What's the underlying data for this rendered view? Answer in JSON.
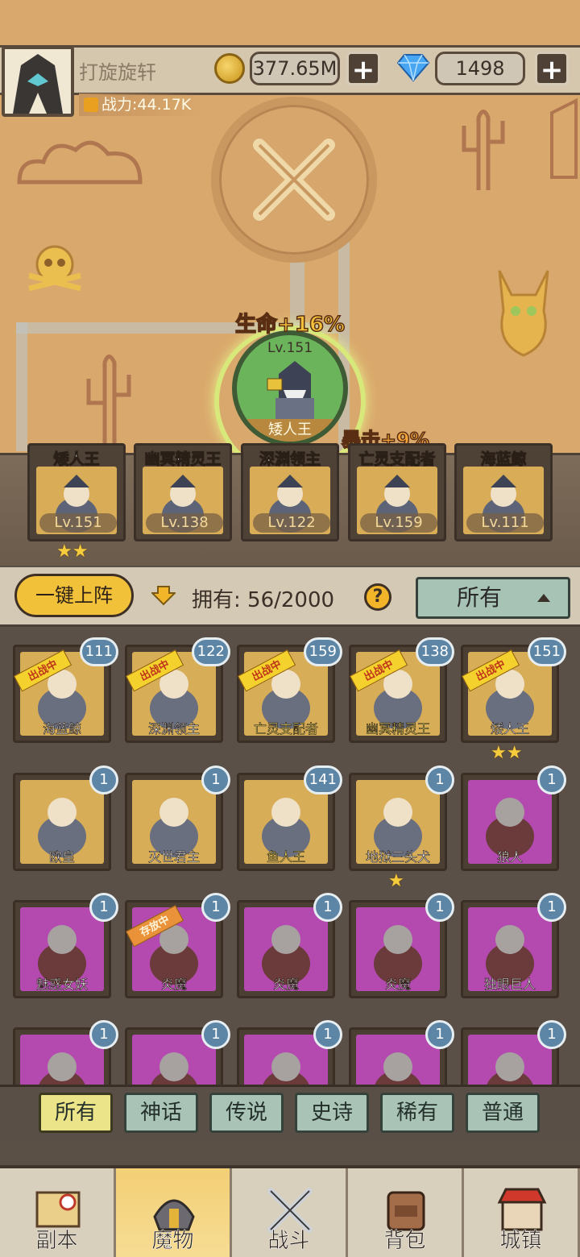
{
  "player": {
    "name": "打旋旋轩",
    "power": "战力:44.17K"
  },
  "currency": {
    "gold": "377.65M",
    "gems": "1498",
    "plus": "+"
  },
  "selected_hero": {
    "level": "Lv.151",
    "name": "矮人王",
    "buff_hp": "生命+16%",
    "buff_crit": "暴击+9%"
  },
  "lineup": [
    {
      "name": "矮人王",
      "level": "Lv.151",
      "stars": "★★"
    },
    {
      "name": "幽冥精灵王",
      "level": "Lv.138",
      "stars": ""
    },
    {
      "name": "深渊领主",
      "level": "Lv.122",
      "stars": ""
    },
    {
      "name": "亡灵支配者",
      "level": "Lv.159",
      "stars": ""
    },
    {
      "name": "海蓝鲸",
      "level": "Lv.111",
      "stars": ""
    }
  ],
  "toolbar": {
    "quick_deploy": "一键上阵",
    "owned_label": "拥有:",
    "owned_value": "56/2000",
    "help": "?",
    "filter": "所有"
  },
  "ribbons": {
    "in_battle": "出战中",
    "stored": "存放中"
  },
  "grid": [
    {
      "name": "海蓝鲸",
      "count": "111",
      "color": "gold",
      "ribbon": "in_battle",
      "stars": ""
    },
    {
      "name": "深渊领主",
      "count": "122",
      "color": "gold",
      "ribbon": "in_battle",
      "stars": ""
    },
    {
      "name": "亡灵支配者",
      "count": "159",
      "color": "gold",
      "ribbon": "in_battle",
      "stars": ""
    },
    {
      "name": "幽冥精灵王",
      "count": "138",
      "color": "gold",
      "ribbon": "in_battle",
      "stars": ""
    },
    {
      "name": "矮人王",
      "count": "151",
      "color": "gold",
      "ribbon": "in_battle",
      "stars": "★★"
    },
    {
      "name": "欧皇",
      "count": "1",
      "color": "gold",
      "ribbon": "",
      "stars": ""
    },
    {
      "name": "灭世君主",
      "count": "1",
      "color": "gold",
      "ribbon": "",
      "stars": ""
    },
    {
      "name": "鱼人王",
      "count": "141",
      "color": "gold",
      "ribbon": "",
      "stars": ""
    },
    {
      "name": "地狱三头犬",
      "count": "1",
      "color": "gold",
      "ribbon": "",
      "stars": "★"
    },
    {
      "name": "狼人",
      "count": "1",
      "color": "purple",
      "ribbon": "",
      "stars": ""
    },
    {
      "name": "魅惑女妖",
      "count": "1",
      "color": "purple",
      "ribbon": "",
      "stars": ""
    },
    {
      "name": "炎魔",
      "count": "1",
      "color": "purple",
      "ribbon": "stored",
      "stars": ""
    },
    {
      "name": "炎魔",
      "count": "1",
      "color": "purple",
      "ribbon": "",
      "stars": ""
    },
    {
      "name": "炎魔",
      "count": "1",
      "color": "purple",
      "ribbon": "",
      "stars": ""
    },
    {
      "name": "独眼巨人",
      "count": "1",
      "color": "purple",
      "ribbon": "",
      "stars": ""
    },
    {
      "name": "",
      "count": "1",
      "color": "purple",
      "ribbon": "",
      "stars": ""
    },
    {
      "name": "",
      "count": "1",
      "color": "purple",
      "ribbon": "",
      "stars": ""
    },
    {
      "name": "",
      "count": "1",
      "color": "purple",
      "ribbon": "",
      "stars": ""
    },
    {
      "name": "",
      "count": "1",
      "color": "purple",
      "ribbon": "",
      "stars": ""
    },
    {
      "name": "",
      "count": "1",
      "color": "purple",
      "ribbon": "",
      "stars": ""
    }
  ],
  "rarity_tabs": [
    "所有",
    "神话",
    "传说",
    "史诗",
    "稀有",
    "普通"
  ],
  "bottom_nav": [
    {
      "label": "副本",
      "icon": "map-icon"
    },
    {
      "label": "魔物",
      "icon": "monster-helmet-icon"
    },
    {
      "label": "战斗",
      "icon": "crossed-swords-icon"
    },
    {
      "label": "背包",
      "icon": "backpack-icon"
    },
    {
      "label": "城镇",
      "icon": "shop-icon"
    }
  ],
  "colors": {
    "gold_card": "#d7ad58",
    "purple_card": "#b44aaf",
    "accent_yellow": "#f2c13a",
    "teal_button": "#a9c4b6"
  }
}
